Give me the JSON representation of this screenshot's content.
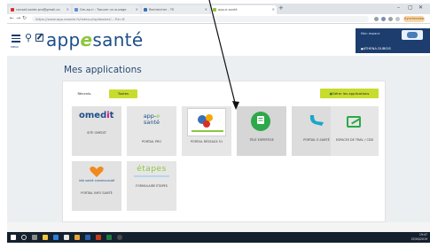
{
  "browser": {
    "tabs": [
      {
        "label": "conseil.sante.pro@gmail.co"
      },
      {
        "label": "Gm.ap.ri : Trouver un ouvage"
      },
      {
        "label": "Rechercher - TE"
      },
      {
        "label": "app-e-santé"
      }
    ],
    "new_tab": "+",
    "window_controls": {
      "minimize": "–",
      "maximize": "▢",
      "close": "✕"
    },
    "nav": {
      "back": "←",
      "forward": "→",
      "reload": "↻",
      "home": "⌂"
    },
    "url": "https://www.app-esante.fr/index.php/dossier/...?tk=8",
    "profile_label": "Synchronise"
  },
  "header": {
    "menu_label": "MENU",
    "logo_prefix": "app",
    "logo_e": "e",
    "logo_suffix": "santé",
    "banner_text": "Mon espace",
    "banner_user": "ATHENA DUBOIS"
  },
  "page": {
    "title": "Mes applications",
    "filter_tabs": {
      "recent": "Récents",
      "all": "Toutes"
    },
    "manage_button": "Gérer les applications",
    "apps": [
      {
        "name": "omedit",
        "label": "SITE OMEDIT"
      },
      {
        "name": "app-e-sante",
        "label": "PORTAIL PRO",
        "logo_text": "app-e santé"
      },
      {
        "name": "sante-nord",
        "label": "PORTAIL RÉSEAUX 51",
        "logo_text": "Sante Normandie Grand-Est"
      },
      {
        "name": "tele-expertise",
        "label": "TÉLÉ EXPERTISE"
      },
      {
        "name": "portail-e-sante",
        "label": "PORTAIL E-SANTÉ"
      },
      {
        "name": "espace-cnp",
        "label": "ESPACES DE TRAV. / CDD"
      },
      {
        "name": "info-sante",
        "label": "PORTAIL INFO SANTÉ",
        "logo_text": "info santé communauté"
      },
      {
        "name": "etapes",
        "label": "FORMULAIRE ÉTAPES",
        "logo_text": "étapes"
      }
    ]
  },
  "taskbar": {
    "time": "19:47",
    "date": "25/04/2019"
  },
  "colors": {
    "brand_blue": "#1d4e89",
    "accent_green": "#c8dc2e",
    "logo_green": "#8dc63f"
  }
}
